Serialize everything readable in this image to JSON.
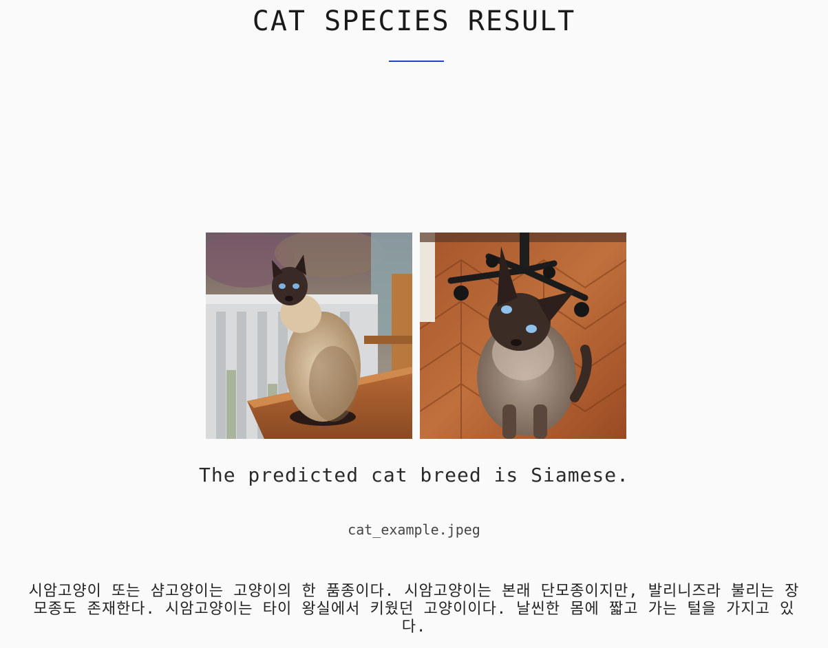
{
  "header": {
    "title": "CAT SPECIES RESULT",
    "accent_color": "#2a3fc9"
  },
  "images": [
    {
      "name": "siamese-cat-photo-1",
      "subject": "Siamese cat sitting on a wooden table on a balcony"
    },
    {
      "name": "siamese-cat-photo-2",
      "subject": "Siamese cat sitting on a parquet floor near an office chair"
    }
  ],
  "result": {
    "prediction_text": "The predicted cat breed is Siamese.",
    "filename": "cat_example.jpeg",
    "description": "시암고양이 또는 샴고양이는 고양이의 한 품종이다. 시암고양이는 본래 단모종이지만, 발리니즈라 불리는 장모종도 존재한다. 시암고양이는 타이 왕실에서 키웠던 고양이이다. 날씬한 몸에 짧고 가는 털을 가지고 있다."
  }
}
